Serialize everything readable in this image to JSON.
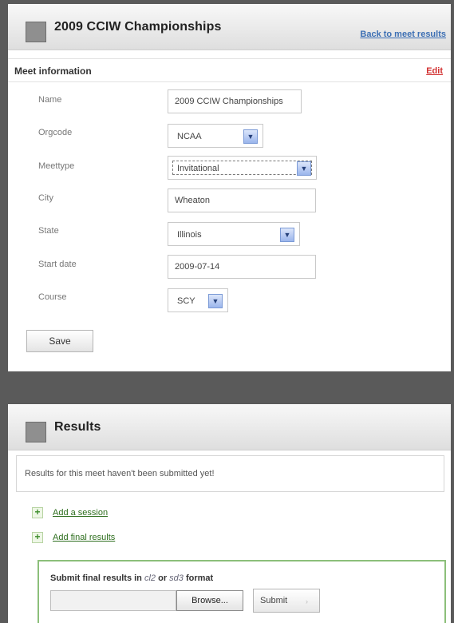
{
  "meet": {
    "title": "2009 CCIW Championships",
    "back_link": "Back to meet results",
    "section_title": "Meet information",
    "edit_label": "Edit",
    "fields": {
      "name": {
        "label": "Name",
        "value": "2009 CCIW Championships"
      },
      "orgcode": {
        "label": "Orgcode",
        "value": "NCAA"
      },
      "meettype": {
        "label": "Meettype",
        "value": "Invitational"
      },
      "city": {
        "label": "City",
        "value": "Wheaton"
      },
      "state": {
        "label": "State",
        "value": "Illinois"
      },
      "start_date": {
        "label": "Start date",
        "value": "2009-07-14"
      },
      "course": {
        "label": "Course",
        "value": "SCY"
      }
    },
    "save_label": "Save"
  },
  "results": {
    "title": "Results",
    "notice": "Results for this meet haven't been submitted yet!",
    "add_session": "Add a session",
    "add_final": "Add final results",
    "submit_box": {
      "heading_prefix": "Submit final results in",
      "format_1": "cl2",
      "or_text": "or",
      "format_2": "sd3",
      "heading_suffix": "format",
      "browse_label": "Browse...",
      "submit_label": "Submit"
    }
  },
  "icons": {
    "dropdown": "chevron-down-icon",
    "plus": "plus-icon",
    "panel": "square-icon"
  },
  "colors": {
    "link_blue": "#3c6fb4",
    "edit_red": "#d23030",
    "action_green": "#2e6e1e",
    "box_border_green": "#8cbf7a"
  }
}
